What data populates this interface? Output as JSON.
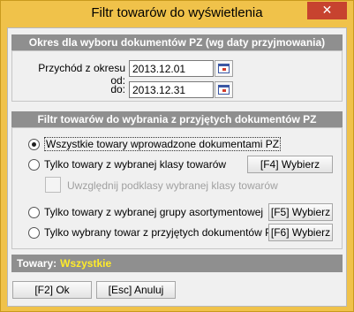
{
  "window": {
    "title": "Filtr towarów do wyświetlenia",
    "close_glyph": "✕"
  },
  "dates": {
    "header": "Okres dla wyboru dokumentów PZ (wg daty przyjmowania)",
    "from_label": "Przychód z okresu od:",
    "from_value": "2013.12.01",
    "to_label": "do:",
    "to_value": "2013.12.31"
  },
  "filter": {
    "header": "Filtr towarów do wybrania z przyjętych dokumentów PZ",
    "options": [
      {
        "label": "Wszystkie towary wprowadzone dokumentami PZ",
        "checked": true
      },
      {
        "label": "Tylko towary z wybranej klasy towarów",
        "checked": false
      },
      {
        "label": "Tylko towary z wybranej grupy asortymentowej",
        "checked": false
      },
      {
        "label": "Tylko wybrany towar z przyjętych dokumentów PZ",
        "checked": false
      }
    ],
    "subclass_checkbox_label": "Uwzględnij podklasy wybranej klasy towarów",
    "btn_class": "[F4] Wybierz",
    "btn_group": "[F5] Wybierz",
    "btn_product": "[F6] Wybierz"
  },
  "status": {
    "label": "Towary:",
    "value": "Wszystkie"
  },
  "footer": {
    "ok": "[F2] Ok",
    "cancel": "[Esc] Anuluj"
  }
}
